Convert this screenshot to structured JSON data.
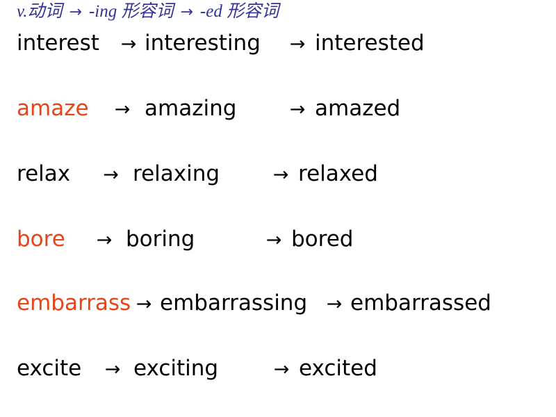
{
  "slide": {
    "background_color": "#ffffff",
    "accent_color": "#e8441a",
    "header_color": "#333399",
    "body_color": "#000000",
    "header": {
      "part1": "v.动词",
      "arrow1": "→",
      "part2": "-ing 形容词",
      "arrow2": "→",
      "part3": "-ed 形容词"
    },
    "arrow": "→",
    "rows": [
      {
        "base": "interest",
        "ing": "interesting",
        "ed": "interested",
        "highlight": false
      },
      {
        "base": "amaze",
        "ing": "amazing",
        "ed": "amazed",
        "highlight": true
      },
      {
        "base": "relax",
        "ing": "relaxing",
        "ed": "relaxed",
        "highlight": false
      },
      {
        "base": "bore",
        "ing": "boring",
        "ed": "bored",
        "highlight": true
      },
      {
        "base": "embarrass",
        "ing": "embarrassing",
        "ed": "embarrassed",
        "highlight": true
      },
      {
        "base": "excite",
        "ing": "exciting",
        "ed": "excited",
        "highlight": false
      }
    ]
  }
}
